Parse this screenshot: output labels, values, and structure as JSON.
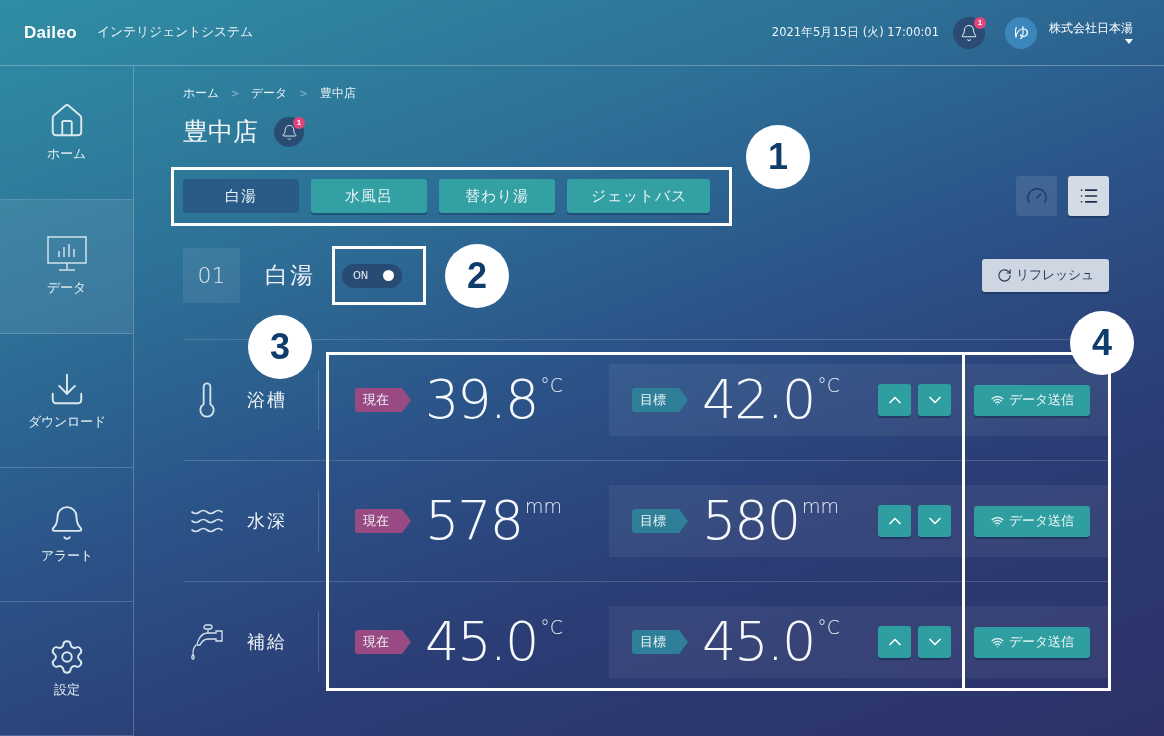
{
  "header": {
    "logo": "Daileo",
    "system_name": "インテリジェントシステム",
    "datetime": "2021年5月15日 (火) 17:00:01",
    "notification_badge": "1",
    "avatar": "ゆ",
    "company": "株式会社日本湯"
  },
  "sidebar": {
    "items": [
      {
        "label": "ホーム",
        "selected": false
      },
      {
        "label": "データ",
        "selected": true
      },
      {
        "label": "ダウンロード",
        "selected": false
      },
      {
        "label": "アラート",
        "selected": false
      },
      {
        "label": "設定",
        "selected": false
      }
    ]
  },
  "breadcrumb": {
    "items": [
      "ホーム",
      "データ",
      "豊中店"
    ],
    "separators": [
      ">",
      ">"
    ]
  },
  "page": {
    "title": "豊中店",
    "alert_badge": "1"
  },
  "tabs": [
    {
      "label": "白湯",
      "selected": true
    },
    {
      "label": "水風呂",
      "selected": false
    },
    {
      "label": "替わり湯",
      "selected": false
    },
    {
      "label": "ジェットバス",
      "selected": false
    }
  ],
  "view_switch": [
    {
      "selected": false
    },
    {
      "selected": true
    }
  ],
  "bath": {
    "number": "01",
    "name": "白湯",
    "switch": {
      "label": "ON",
      "on": true
    }
  },
  "refresh_button": "リフレッシュ",
  "measurements": [
    {
      "label": "浴槽",
      "current_tag": "現在",
      "current_value": "39.8",
      "current_unit": "°C",
      "target_tag": "目標",
      "target_value": "42.0",
      "target_unit": "°C",
      "send_button": "データ送信"
    },
    {
      "label": "水深",
      "current_tag": "現在",
      "current_value": "578",
      "current_unit": "mm",
      "target_tag": "目標",
      "target_value": "580",
      "target_unit": "mm",
      "send_button": "データ送信"
    },
    {
      "label": "補給",
      "current_tag": "現在",
      "current_value": "45.0",
      "current_unit": "°C",
      "target_tag": "目標",
      "target_value": "45.0",
      "target_unit": "°C",
      "send_button": "データ送信"
    }
  ],
  "annotations": [
    {
      "label": "1"
    },
    {
      "label": "2"
    },
    {
      "label": "3"
    },
    {
      "label": "4"
    }
  ]
}
